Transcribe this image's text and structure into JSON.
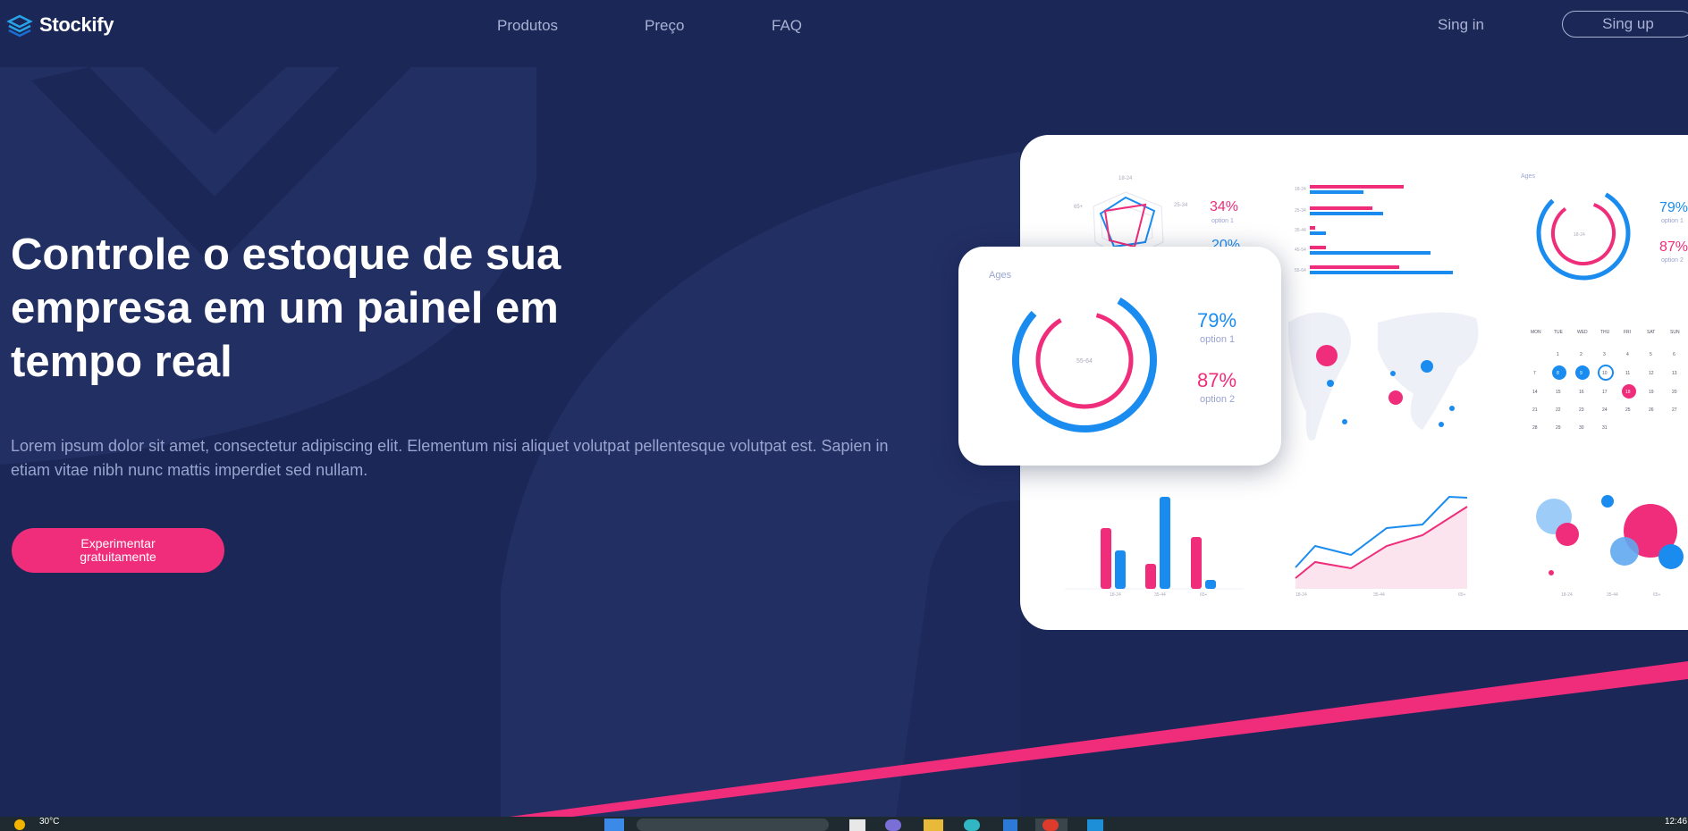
{
  "nav": {
    "brand": "Stockify",
    "links": [
      "Produtos",
      "Preço",
      "FAQ"
    ],
    "signin": "Sing in",
    "signup": "Sing up"
  },
  "hero": {
    "title": "Controle o estoque de sua empresa em um painel em tempo real",
    "description": "Lorem ipsum dolor sit amet, consectetur adipiscing elit. Elementum nisi aliquet volutpat pellentesque volutpat est. Sapien in etiam vitae nibh nunc mattis imperdiet sed nullam.",
    "cta": "Experimentar gratuitamente"
  },
  "dashboard": {
    "card": {
      "title": "Ages",
      "center_label": "55-64",
      "opt1_pct": "79%",
      "opt1_label": "option 1",
      "opt2_pct": "87%",
      "opt2_label": "option 2"
    },
    "top_right": {
      "title": "Ages",
      "center_label": "18-24",
      "opt1_pct": "79%",
      "opt1_label": "option 1",
      "opt2_pct": "87%",
      "opt2_label": "option 2"
    },
    "radar": {
      "pct1": "34%",
      "label1": "option 1",
      "pct2": "20%",
      "tick_top": "18-24",
      "tick_right": "25-34",
      "tick_left": "65+"
    },
    "calendar": {
      "days": [
        "MON",
        "TUE",
        "WED",
        "THU",
        "FRI",
        "SAT",
        "SUN"
      ],
      "dates": [
        "1",
        "2",
        "3",
        "4",
        "5",
        "6",
        "7",
        "8",
        "9",
        "10",
        "11",
        "12",
        "13",
        "14",
        "15",
        "16",
        "17",
        "18",
        "19",
        "20",
        "21",
        "22",
        "23",
        "24",
        "25",
        "26",
        "27",
        "28",
        "29",
        "30",
        "31"
      ]
    },
    "bar_axis": [
      "18-24",
      "35-44",
      "65+"
    ],
    "line_axis": [
      "18-24",
      "35-44",
      "65+"
    ],
    "bubble_axis": [
      "18-24",
      "35-44",
      "65+"
    ],
    "hbar_axis": [
      "18-24",
      "25-34",
      "35-44",
      "45-54",
      "55-64"
    ]
  },
  "colors": {
    "accent": "#ef2d7b",
    "blue": "#1a8cf0",
    "bg": "#1b2757"
  },
  "taskbar": {
    "temp": "30°C",
    "time": "12:46"
  }
}
